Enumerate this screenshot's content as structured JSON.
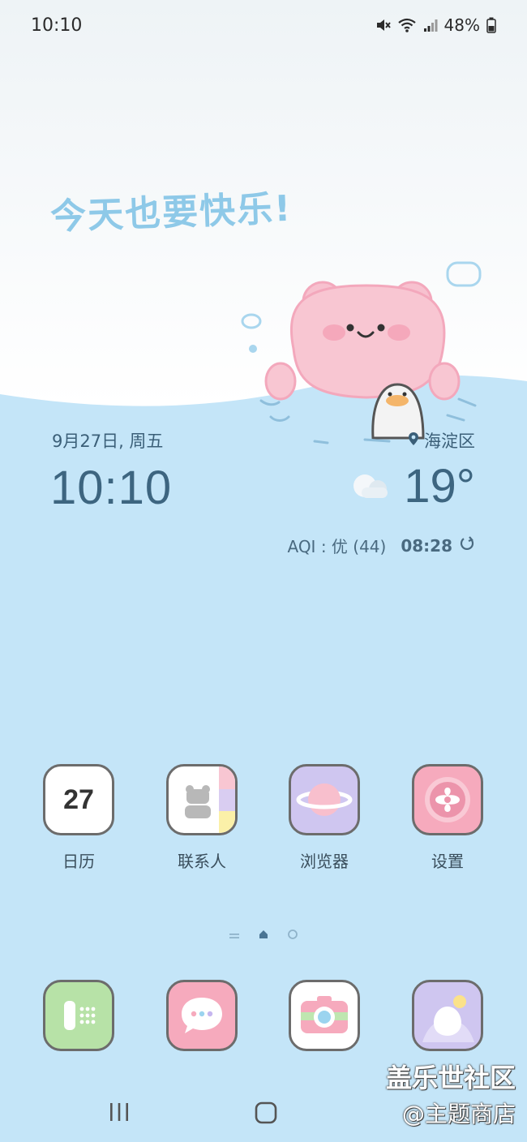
{
  "status_bar": {
    "time": "10:10",
    "battery": "48%"
  },
  "wallpaper": {
    "slogan": "今天也要快乐!"
  },
  "widget": {
    "date": "9月27日, 周五",
    "location": "海淀区",
    "time": "10:10",
    "temperature": "19°",
    "aqi": "AQI : 优 (44)",
    "updated": "08:28"
  },
  "apps": [
    {
      "label": "日历",
      "badge": "27"
    },
    {
      "label": "联系人"
    },
    {
      "label": "浏览器"
    },
    {
      "label": "设置"
    }
  ],
  "page_indicator": {
    "pages": 2,
    "current": 1
  },
  "watermark": {
    "line1": "盖乐世社区",
    "line2": "@主题商店"
  },
  "colors": {
    "sky": "#c4e5f8",
    "accent_pink": "#f6b8c8",
    "text_blue": "#3d6580"
  }
}
